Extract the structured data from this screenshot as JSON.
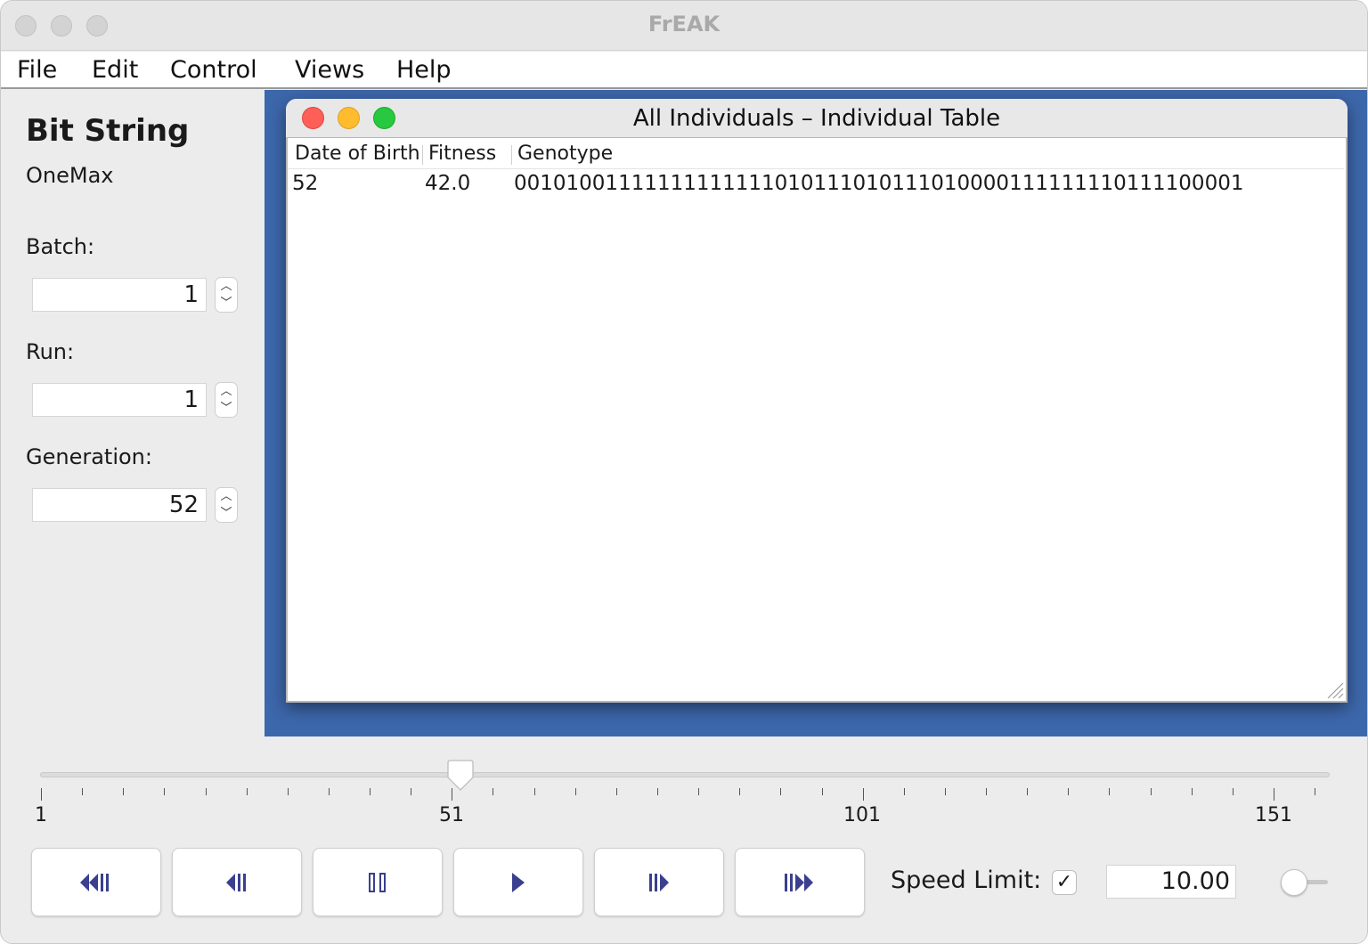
{
  "window": {
    "title": "FrEAK"
  },
  "menu": {
    "items": [
      "File",
      "Edit",
      "Control",
      "Views",
      "Help"
    ]
  },
  "problem": {
    "title": "Bit String",
    "subtitle": "OneMax"
  },
  "fields": {
    "batch": {
      "label": "Batch:",
      "value": "1"
    },
    "run": {
      "label": "Run:",
      "value": "1"
    },
    "generation": {
      "label": "Generation:",
      "value": "52"
    }
  },
  "table_window": {
    "title": "All Individuals – Individual Table",
    "columns": [
      "Date of Birth",
      "Fitness",
      "Genotype"
    ],
    "rows": [
      {
        "date_of_birth": "52",
        "fitness": "42.0",
        "genotype": "00101001111111111111010111010111010000111111110111100001"
      }
    ]
  },
  "generation_slider": {
    "min": 1,
    "max": 159,
    "value": 52,
    "tick_labels": [
      "1",
      "51",
      "101",
      "151"
    ]
  },
  "controls": {
    "buttons": [
      "rewind-icon",
      "step-back-icon",
      "pause-icon",
      "play-icon",
      "step-forward-icon",
      "fast-forward-icon"
    ],
    "speed_limit_label": "Speed Limit:",
    "speed_limit_enabled": true,
    "checkbox_mark": "✓",
    "speed_value": "10.00"
  },
  "colors": {
    "desktop": "#3d67ab",
    "close": "#fe5f57",
    "minimize": "#febc2e",
    "zoom": "#28c840",
    "icon": "#3a3f8f"
  }
}
